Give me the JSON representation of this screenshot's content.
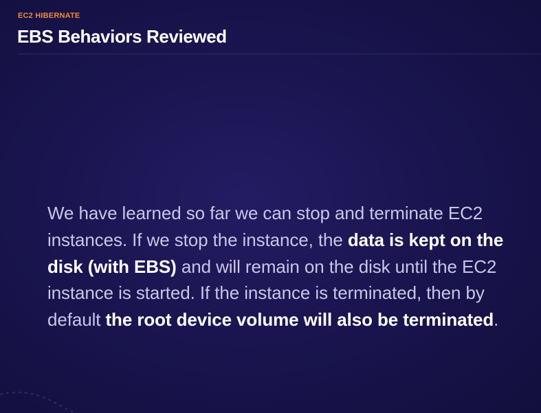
{
  "header": {
    "eyebrow": "EC2 HIBERNATE",
    "title": "EBS Behaviors Reviewed"
  },
  "main": {
    "paragraph": {
      "part1": "We have learned so far we can stop and terminate EC2 instances. If we stop the instance, the ",
      "bold1": "data is kept on the disk (with EBS)",
      "part2": " and will remain on the disk until the EC2 instance is started. If the instance is terminated, then by default ",
      "bold2": "the root device volume will also be terminated",
      "part3": "."
    }
  },
  "colors": {
    "background": "#1a1550",
    "accent": "#f08a3c",
    "title": "#ffffff",
    "body_text": "#c9c6e6",
    "emphasis": "#ffffff"
  }
}
